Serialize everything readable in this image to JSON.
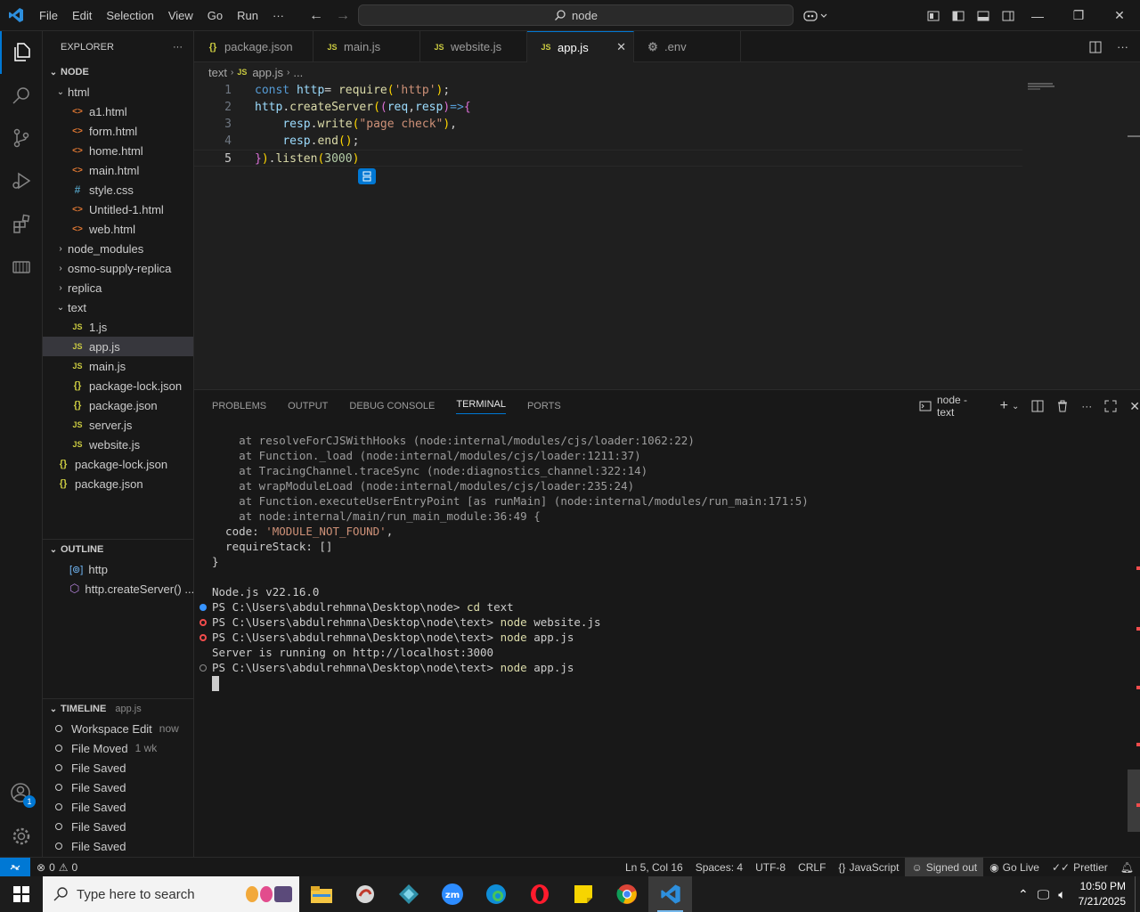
{
  "titlebar": {
    "menu": [
      "File",
      "Edit",
      "Selection",
      "View",
      "Go",
      "Run",
      "···"
    ],
    "search_text": "node"
  },
  "sidebar": {
    "explorer_title": "EXPLORER",
    "root": "NODE",
    "tree": [
      {
        "type": "folder",
        "label": "html",
        "open": true,
        "depth": 1
      },
      {
        "type": "html",
        "label": "a1.html",
        "depth": 2
      },
      {
        "type": "html",
        "label": "form.html",
        "depth": 2
      },
      {
        "type": "html",
        "label": "home.html",
        "depth": 2
      },
      {
        "type": "html",
        "label": "main.html",
        "depth": 2
      },
      {
        "type": "css",
        "label": "style.css",
        "depth": 2
      },
      {
        "type": "html",
        "label": "Untitled-1.html",
        "depth": 2
      },
      {
        "type": "html",
        "label": "web.html",
        "depth": 2
      },
      {
        "type": "folder",
        "label": "node_modules",
        "open": false,
        "depth": 1
      },
      {
        "type": "folder",
        "label": "osmo-supply-replica",
        "open": false,
        "depth": 1
      },
      {
        "type": "folder",
        "label": "replica",
        "open": false,
        "depth": 1
      },
      {
        "type": "folder",
        "label": "text",
        "open": true,
        "depth": 1
      },
      {
        "type": "js",
        "label": "1.js",
        "depth": 2
      },
      {
        "type": "js",
        "label": "app.js",
        "depth": 2,
        "selected": true
      },
      {
        "type": "js",
        "label": "main.js",
        "depth": 2
      },
      {
        "type": "json",
        "label": "package-lock.json",
        "depth": 2
      },
      {
        "type": "json",
        "label": "package.json",
        "depth": 2
      },
      {
        "type": "js",
        "label": "server.js",
        "depth": 2
      },
      {
        "type": "js",
        "label": "website.js",
        "depth": 2
      },
      {
        "type": "json",
        "label": "package-lock.json",
        "depth": 1
      },
      {
        "type": "json",
        "label": "package.json",
        "depth": 1
      }
    ],
    "outline_title": "OUTLINE",
    "outline": [
      "http",
      "http.createServer() ..."
    ],
    "timeline_title": "TIMELINE",
    "timeline_file": "app.js",
    "timeline": [
      {
        "label": "Workspace Edit",
        "meta": "now"
      },
      {
        "label": "File Moved",
        "meta": "1 wk"
      },
      {
        "label": "File Saved",
        "meta": ""
      },
      {
        "label": "File Saved",
        "meta": ""
      },
      {
        "label": "File Saved",
        "meta": ""
      },
      {
        "label": "File Saved",
        "meta": ""
      },
      {
        "label": "File Saved",
        "meta": ""
      }
    ],
    "accounts_badge": "1"
  },
  "tabs": [
    {
      "label": "package.json",
      "icon": "json",
      "active": false
    },
    {
      "label": "main.js",
      "icon": "js",
      "active": false
    },
    {
      "label": "website.js",
      "icon": "js",
      "active": false
    },
    {
      "label": "app.js",
      "icon": "js",
      "active": true
    },
    {
      "label": ".env",
      "icon": "gear",
      "active": false
    }
  ],
  "breadcrumb": {
    "folder": "text",
    "file": "app.js",
    "more": "..."
  },
  "code": {
    "line_numbers": [
      "1",
      "2",
      "3",
      "4",
      "5"
    ],
    "current_line": 5
  },
  "panel": {
    "tabs": [
      "PROBLEMS",
      "OUTPUT",
      "DEBUG CONSOLE",
      "TERMINAL",
      "PORTS"
    ],
    "active_tab": "TERMINAL",
    "terminal_name": "node - text",
    "lines": [
      {
        "text": "    at resolveForCJSWithHooks (node:internal/modules/cjs/loader:1062:22)",
        "mark": ""
      },
      {
        "text": "    at Function._load (node:internal/modules/cjs/loader:1211:37)",
        "mark": ""
      },
      {
        "text": "    at TracingChannel.traceSync (node:diagnostics_channel:322:14)",
        "mark": ""
      },
      {
        "text": "    at wrapModuleLoad (node:internal/modules/cjs/loader:235:24)",
        "mark": ""
      },
      {
        "text": "    at Function.executeUserEntryPoint [as runMain] (node:internal/modules/run_main:171:5)",
        "mark": ""
      },
      {
        "text": "    at node:internal/main/run_main_module:36:49 {",
        "mark": ""
      },
      {
        "text": "  code: 'MODULE_NOT_FOUND',",
        "mark": ""
      },
      {
        "text": "  requireStack: []",
        "mark": ""
      },
      {
        "text": "}",
        "mark": ""
      },
      {
        "text": "",
        "mark": ""
      },
      {
        "text": "Node.js v22.16.0",
        "mark": ""
      },
      {
        "text": "PS C:\\Users\\abdulrehmna\\Desktop\\node> cd text",
        "mark": "blue"
      },
      {
        "text": "PS C:\\Users\\abdulrehmna\\Desktop\\node\\text> node website.js",
        "mark": "red"
      },
      {
        "text": "PS C:\\Users\\abdulrehmna\\Desktop\\node\\text> node app.js",
        "mark": "red"
      },
      {
        "text": "Server is running on http://localhost:3000",
        "mark": ""
      },
      {
        "text": "PS C:\\Users\\abdulrehmna\\Desktop\\node\\text> node app.js",
        "mark": "gray"
      }
    ]
  },
  "status": {
    "errors": "0",
    "warnings": "0",
    "position": "Ln 5, Col 16",
    "spaces": "Spaces: 4",
    "encoding": "UTF-8",
    "eol": "CRLF",
    "language": "JavaScript",
    "account": "Signed out",
    "golive": "Go Live",
    "prettier": "Prettier"
  },
  "taskbar": {
    "search_placeholder": "Type here to search",
    "time": "10:50 PM",
    "date": "7/21/2025"
  },
  "colors": {
    "accent": "#0078d4",
    "error": "#f14c4c",
    "status_remote": "#0078d4"
  }
}
